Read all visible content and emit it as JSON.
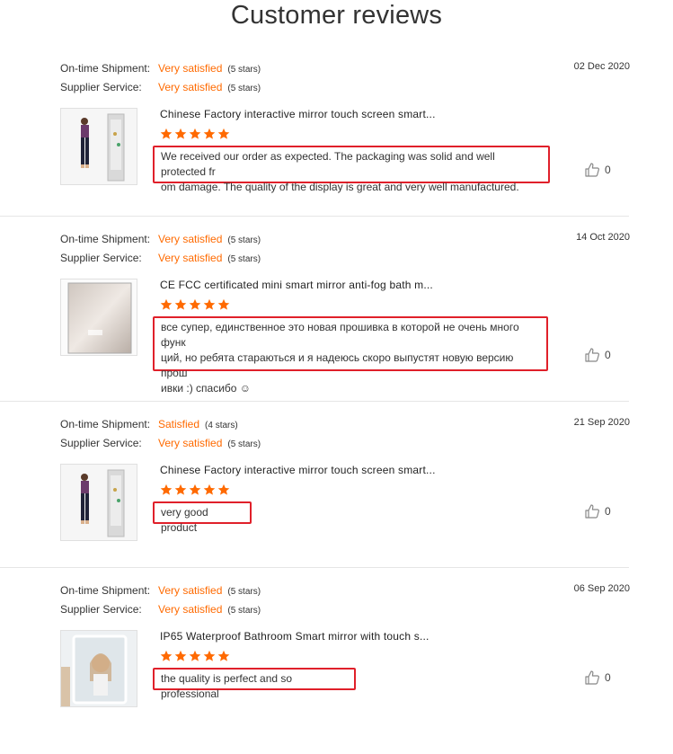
{
  "page": {
    "title": "Customer reviews"
  },
  "labels": {
    "shipment": "On-time Shipment:",
    "supplier": "Supplier Service:"
  },
  "reviews": [
    {
      "date": "02 Dec 2020",
      "shipment_rating": "Very satisfied",
      "shipment_stars": "(5 stars)",
      "supplier_rating": "Very satisfied",
      "supplier_stars": "(5 stars)",
      "product_title": "Chinese Factory interactive mirror touch screen smart...",
      "product_image": "woman-mirror",
      "stars": 5,
      "comment_lines": [
        "We received our order as expected. The packaging was solid and well protected fr",
        "om damage. The quality of the display is great and very well manufactured."
      ],
      "likes": "0"
    },
    {
      "date": "14 Oct 2020",
      "shipment_rating": "Very satisfied",
      "shipment_stars": "(5 stars)",
      "supplier_rating": "Very satisfied",
      "supplier_stars": "(5 stars)",
      "product_title": "CE FCC certificated mini smart mirror anti-fog bath m...",
      "product_image": "mini-mirror",
      "stars": 5,
      "comment_lines": [
        "все супер, единственное это новая прошивка в которой не очень много функ",
        "ций, но ребята стараються и я надеюсь скоро выпустят новую версию прош",
        "ивки :) спасибо ☺"
      ],
      "likes": "0"
    },
    {
      "date": "21 Sep 2020",
      "shipment_rating": "Satisfied",
      "shipment_stars": "(4 stars)",
      "supplier_rating": "Very satisfied",
      "supplier_stars": "(5 stars)",
      "product_title": "Chinese Factory interactive mirror touch screen smart...",
      "product_image": "woman-mirror",
      "stars": 5,
      "comment_lines": [
        "very good product"
      ],
      "likes": "0"
    },
    {
      "date": "06 Sep 2020",
      "shipment_rating": "Very satisfied",
      "shipment_stars": "(5 stars)",
      "supplier_rating": "Very satisfied",
      "supplier_stars": "(5 stars)",
      "product_title": "IP65 Waterproof Bathroom Smart mirror with touch s...",
      "product_image": "bathroom-mirror",
      "stars": 5,
      "comment_lines": [
        "the quality is perfect and so professional"
      ],
      "likes": "0"
    }
  ],
  "colors": {
    "accent": "#ff6a00",
    "highlight_border": "#e0202a"
  }
}
